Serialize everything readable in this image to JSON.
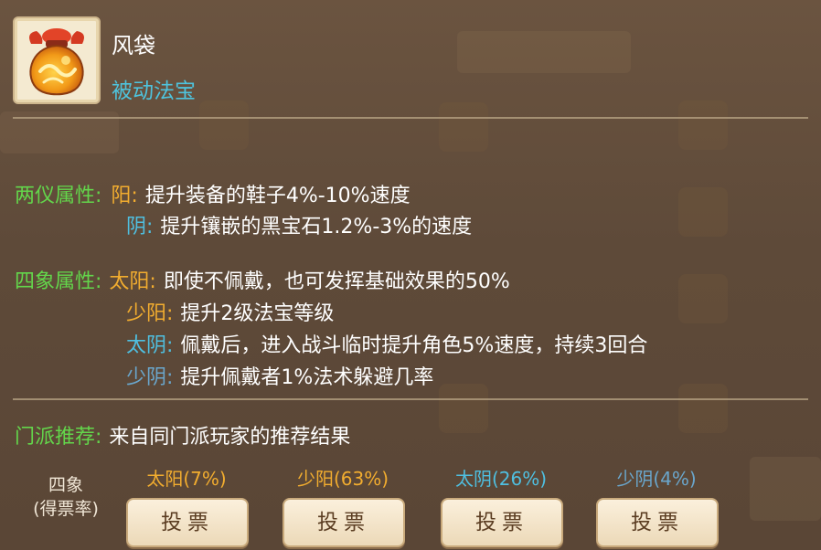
{
  "item": {
    "name": "风袋",
    "type": "被动法宝"
  },
  "liangyi": {
    "category": "两仪属性:",
    "yang_tag": "阳:",
    "yang_text": "提升装备的鞋子4%-10%速度",
    "yin_tag": "阴:",
    "yin_text": "提升镶嵌的黑宝石1.2%-3%的速度"
  },
  "sixiang": {
    "category": "四象属性:",
    "taiyang_tag": "太阳:",
    "taiyang_text": "即使不佩戴，也可发挥基础效果的50%",
    "shaoyang_tag": "少阳:",
    "shaoyang_text": "提升2级法宝等级",
    "taiyin_tag": "太阴:",
    "taiyin_text": "佩戴后，进入战斗临时提升角色5%速度，持续3回合",
    "shaoyin_tag": "少阴:",
    "shaoyin_text": "提升佩戴者1%法术躲避几率"
  },
  "recommend": {
    "category": "门派推荐:",
    "text": "来自同门派玩家的推荐结果"
  },
  "vote": {
    "label_line1": "四象",
    "label_line2": "(得票率)",
    "options": [
      {
        "label": "太阳(7%)",
        "button": "投票"
      },
      {
        "label": "少阳(63%)",
        "button": "投票"
      },
      {
        "label": "太阴(26%)",
        "button": "投票"
      },
      {
        "label": "少阴(4%)",
        "button": "投票"
      }
    ]
  },
  "colors": {
    "category": "#63d64b",
    "yang": "#f2ad2f",
    "yin": "#4fbfe0",
    "item_type": "#4ec3dd"
  },
  "icons": {
    "item_icon": "wind-bag-icon"
  }
}
